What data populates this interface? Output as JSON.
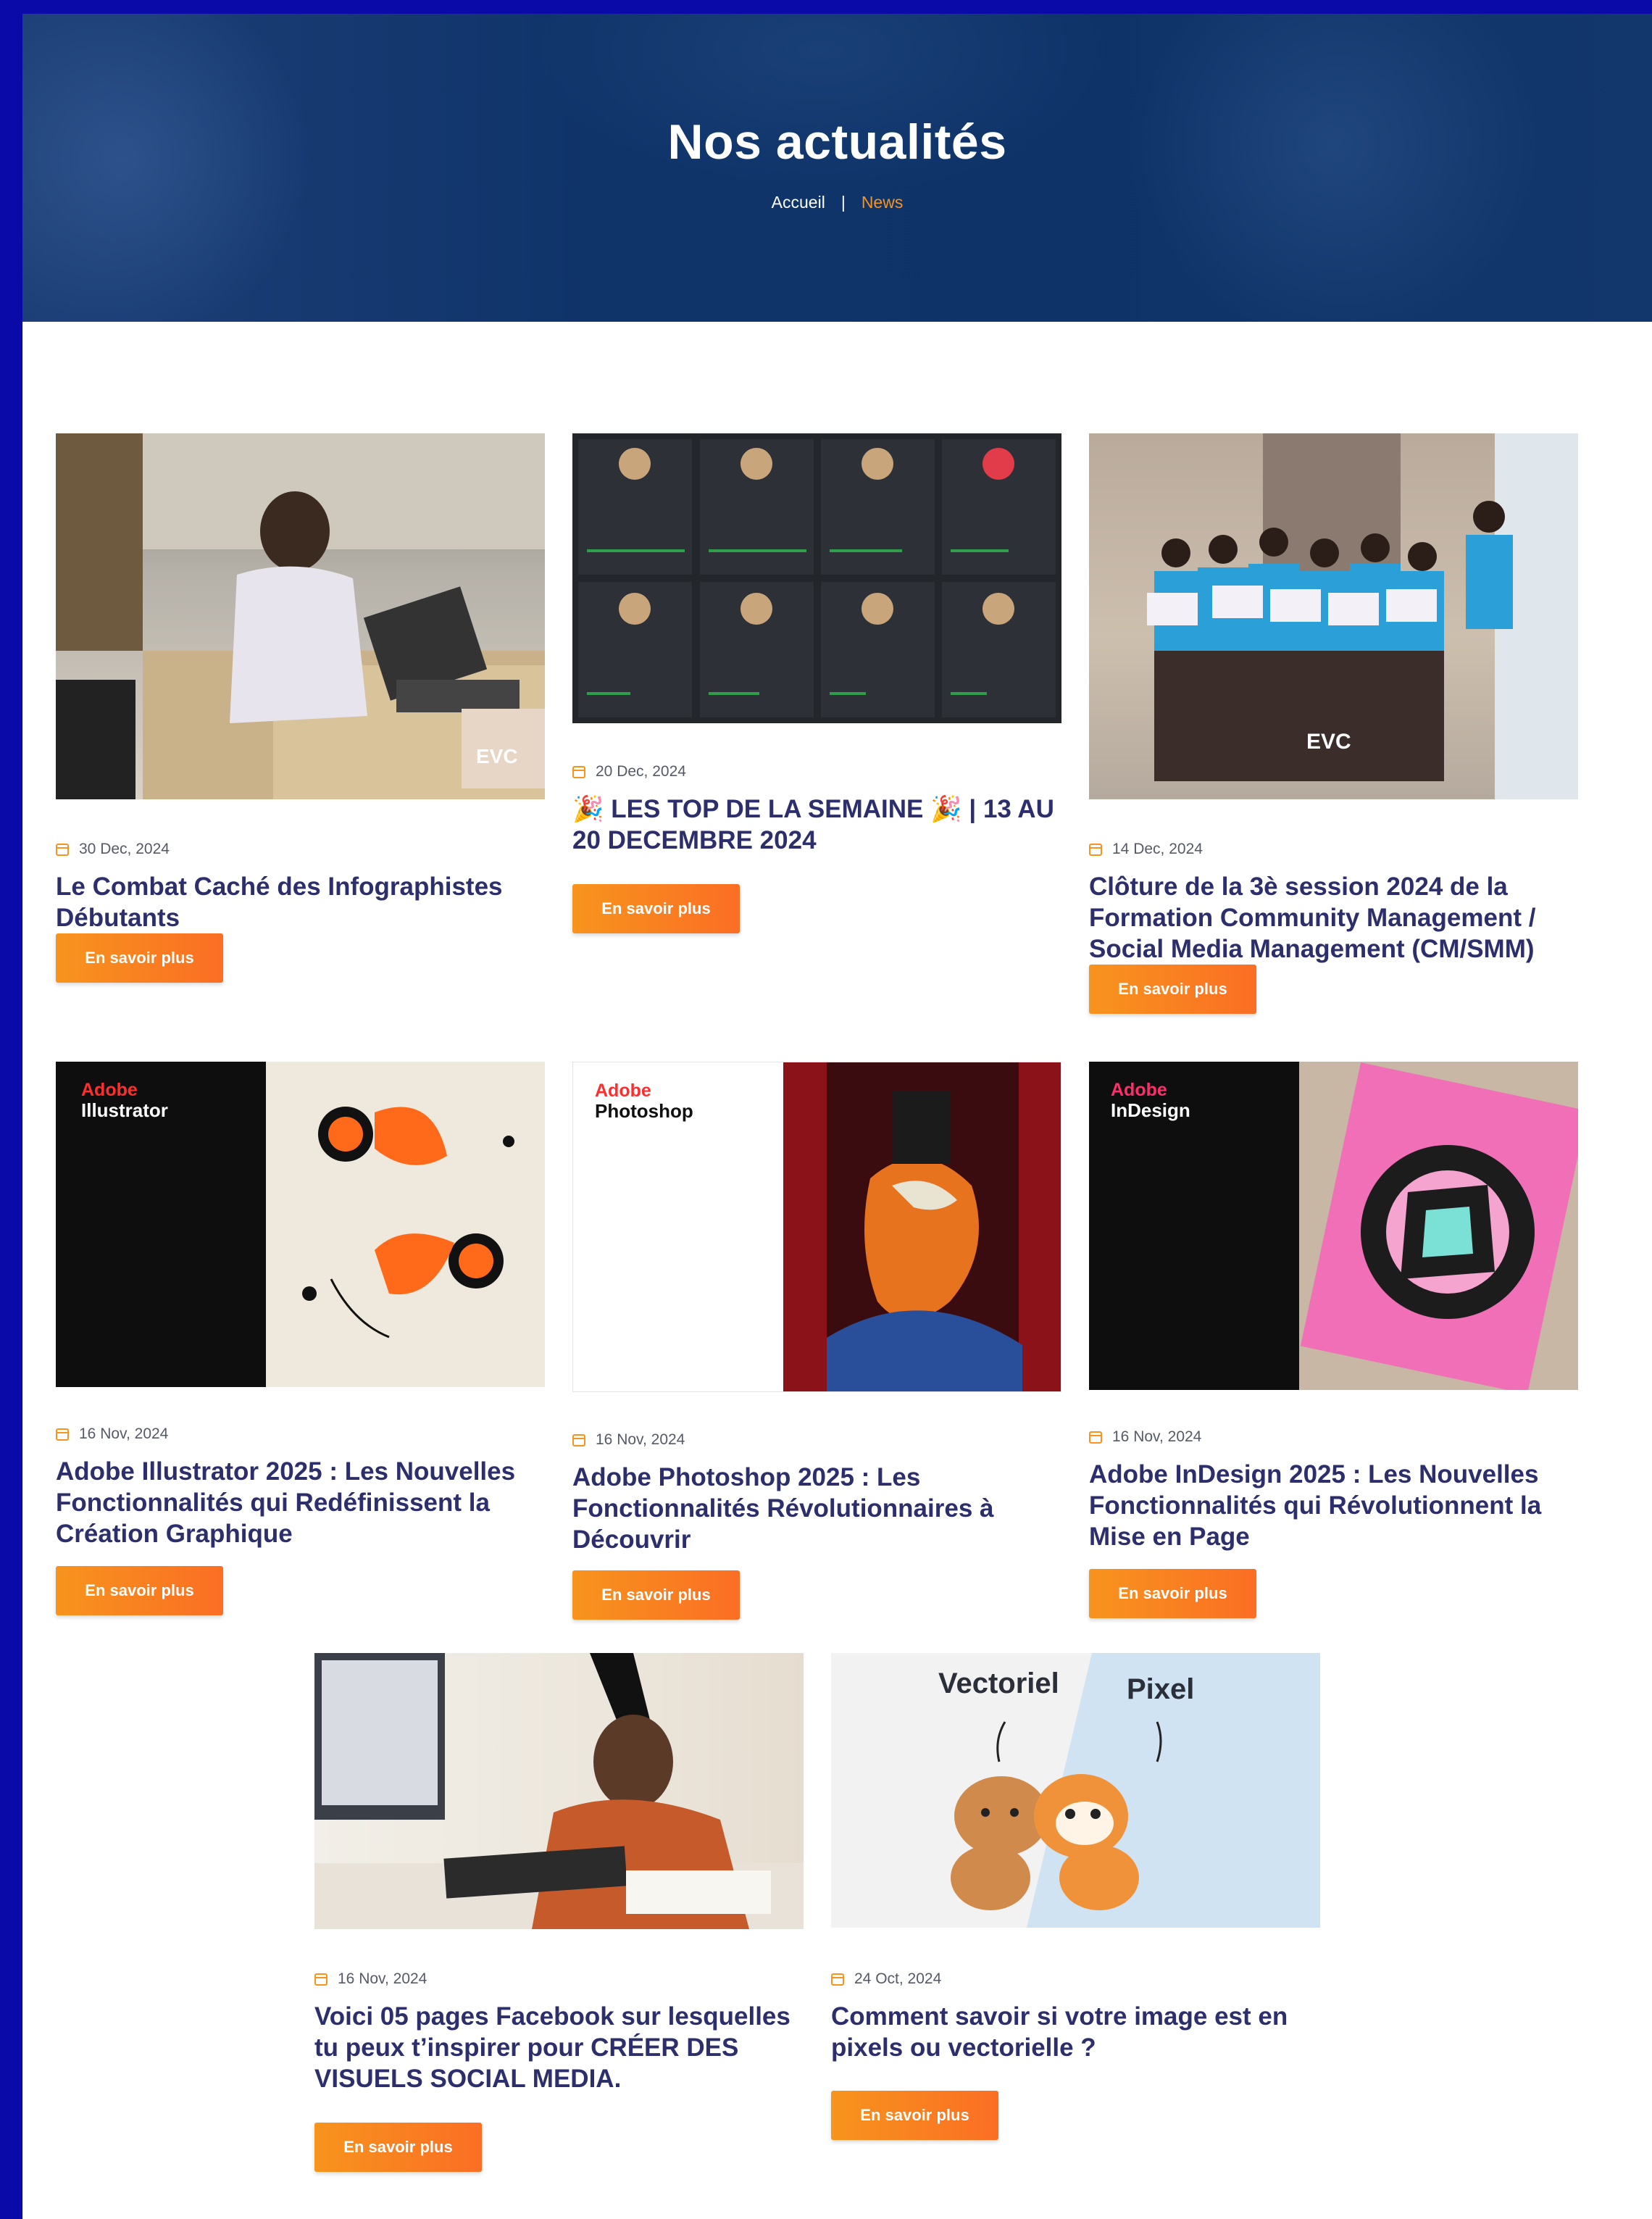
{
  "hero": {
    "title": "Nos actualités",
    "breadcrumb": {
      "home": "Accueil",
      "separator": "|",
      "current": "News"
    }
  },
  "colors": {
    "accent": "#f7941d",
    "title": "#2c2f6b",
    "hero_bg": "#0f346a",
    "frame": "#0a0aa8"
  },
  "button_label": "En savoir plus",
  "posts": [
    {
      "date": "30 Dec, 2024",
      "title": "Le Combat Caché des Infographistes Débutants",
      "image": "photo-designer-at-laptop"
    },
    {
      "date": "20 Dec, 2024",
      "title": "🎉 LES TOP DE LA SEMAINE 🎉 | 13 AU 20 DECEMBRE 2024",
      "image": "leaderboard-dashboard"
    },
    {
      "date": "14 Dec, 2024",
      "title": "Clôture de la 3è session 2024 de la Formation Community Management / Social Media Management (CM/SMM)",
      "image": "group-certificates-photo"
    },
    {
      "date": "16 Nov, 2024",
      "title": "Adobe Illustrator 2025 : Les Nouvelles Fonctionnalités qui Redéfinissent la Création Graphique",
      "image": "illustrator-splash",
      "splash": {
        "brand": "Adobe",
        "product": "Illustrator"
      }
    },
    {
      "date": "16 Nov, 2024",
      "title": "Adobe Photoshop 2025 : Les Fonctionnalités Révolutionnaires à Découvrir",
      "image": "photoshop-splash",
      "splash": {
        "brand": "Adobe",
        "product": "Photoshop"
      }
    },
    {
      "date": "16 Nov, 2024",
      "title": "Adobe InDesign 2025 : Les Nouvelles Fonctionnalités qui Révolutionnent la Mise en Page",
      "image": "indesign-splash",
      "splash": {
        "brand": "Adobe",
        "product": "InDesign"
      }
    },
    {
      "date": "16 Nov, 2024",
      "title": "Voici 05 pages Facebook sur lesquelles tu peux t’inspirer pour CRÉER DES VISUELS SOCIAL MEDIA.",
      "image": "woman-drawing-tablet-photo"
    },
    {
      "date": "24 Oct, 2024",
      "title": "Comment savoir si votre image est en pixels ou vectorielle ?",
      "image": "vector-vs-pixel-dogs",
      "art": {
        "left_label": "Vectoriel",
        "right_label": "Pixel"
      }
    }
  ]
}
